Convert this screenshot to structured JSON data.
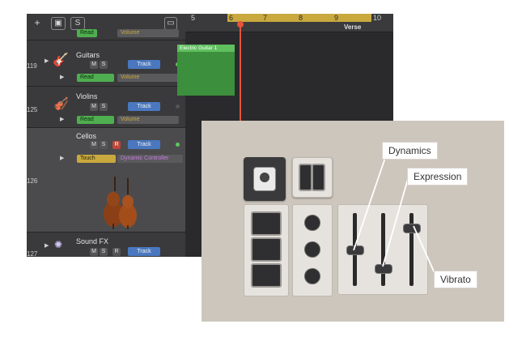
{
  "toolbar": {
    "add_label": "+",
    "s_label": "S"
  },
  "ruler": {
    "bars": [
      "5",
      "6",
      "7",
      "8",
      "9",
      "10"
    ],
    "marker_label": "Verse"
  },
  "tracks": [
    {
      "number": "119",
      "name": "Guitars",
      "mute": "M",
      "solo": "S",
      "track_label": "Track",
      "auto_mode": "Read",
      "auto_param": "Volume"
    },
    {
      "number": "125",
      "name": "Violins",
      "mute": "M",
      "solo": "S",
      "track_label": "Track",
      "auto_mode": "Read",
      "auto_param": "Volume"
    },
    {
      "number": "126",
      "name": "Cellos",
      "mute": "M",
      "solo": "S",
      "record": "R",
      "track_label": "Track",
      "auto_mode": "Touch",
      "auto_param": "Dynamic Controller"
    },
    {
      "number": "127",
      "name": "Sound FX",
      "mute": "M",
      "solo": "S",
      "record": "R",
      "track_label": "Track"
    }
  ],
  "top_partial": {
    "auto_mode": "Read",
    "auto_param": "Volume"
  },
  "region": {
    "label": "Electric Guitar 1"
  },
  "callouts": {
    "dynamics": "Dynamics",
    "expression": "Expression",
    "vibrato": "Vibrato"
  },
  "colors": {
    "accent_yellow": "#c9a93e",
    "track_blue": "#4a78c0",
    "region_green": "#3c8f3c",
    "playhead_red": "#e5533b"
  }
}
